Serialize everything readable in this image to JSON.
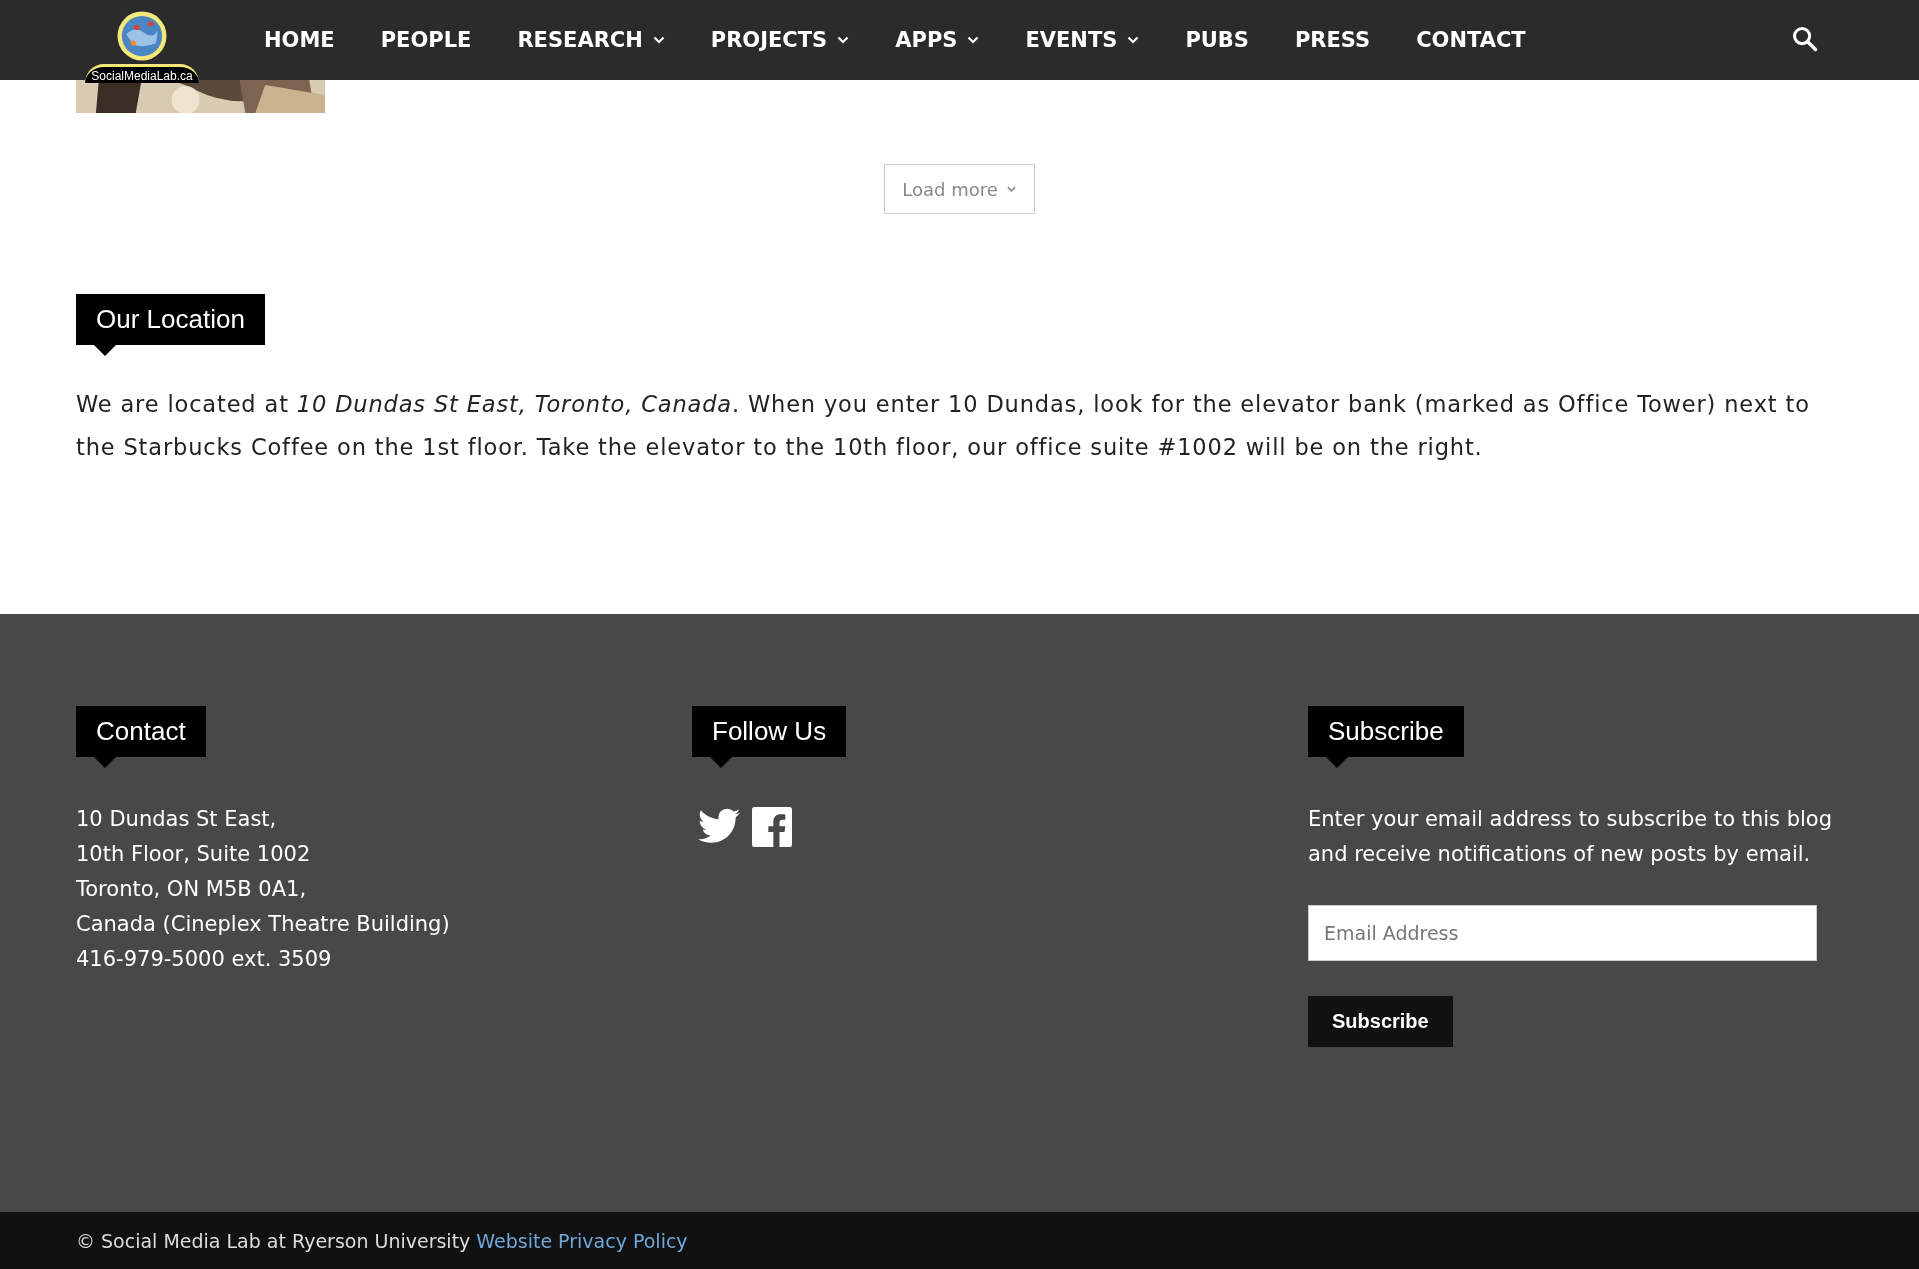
{
  "header": {
    "logo_text": "SocialMediaLab.ca",
    "nav": [
      {
        "label": "HOME",
        "dropdown": false
      },
      {
        "label": "PEOPLE",
        "dropdown": false
      },
      {
        "label": "RESEARCH",
        "dropdown": true
      },
      {
        "label": "PROJECTS",
        "dropdown": true
      },
      {
        "label": "APPS",
        "dropdown": true
      },
      {
        "label": "EVENTS",
        "dropdown": true
      },
      {
        "label": "PUBS",
        "dropdown": false
      },
      {
        "label": "PRESS",
        "dropdown": false
      },
      {
        "label": "CONTACT",
        "dropdown": false
      }
    ]
  },
  "load_more": "Load more",
  "location": {
    "title": "Our Location",
    "text": "We are located at *10 Dundas St East, Toronto, Canada*. When you enter 10 Dundas, look for the elevator bank (marked as Office Tower) next to the Starbucks Coffee on the 1st floor. Take the elevator to the 10th floor, our office suite #1002 will be on the right."
  },
  "footer": {
    "contact": {
      "title": "Contact",
      "lines": [
        "10 Dundas St East,",
        "10th Floor, Suite 1002",
        "Toronto, ON M5B 0A1,",
        "Canada (Cineplex Theatre Building)",
        "416-979-5000 ext. 3509"
      ]
    },
    "follow": {
      "title": "Follow Us",
      "icons": [
        {
          "kind": "twitter"
        },
        {
          "kind": "facebook"
        }
      ]
    },
    "subscribe": {
      "title": "Subscribe",
      "text": "Enter your email address to subscribe to this blog and receive notifications of new posts by email.",
      "placeholder": "Email Address",
      "button": "Subscribe"
    }
  },
  "bottom_bar": {
    "copyright": "© Social Media Lab at Ryerson University",
    "link": "Website Privacy Policy"
  }
}
